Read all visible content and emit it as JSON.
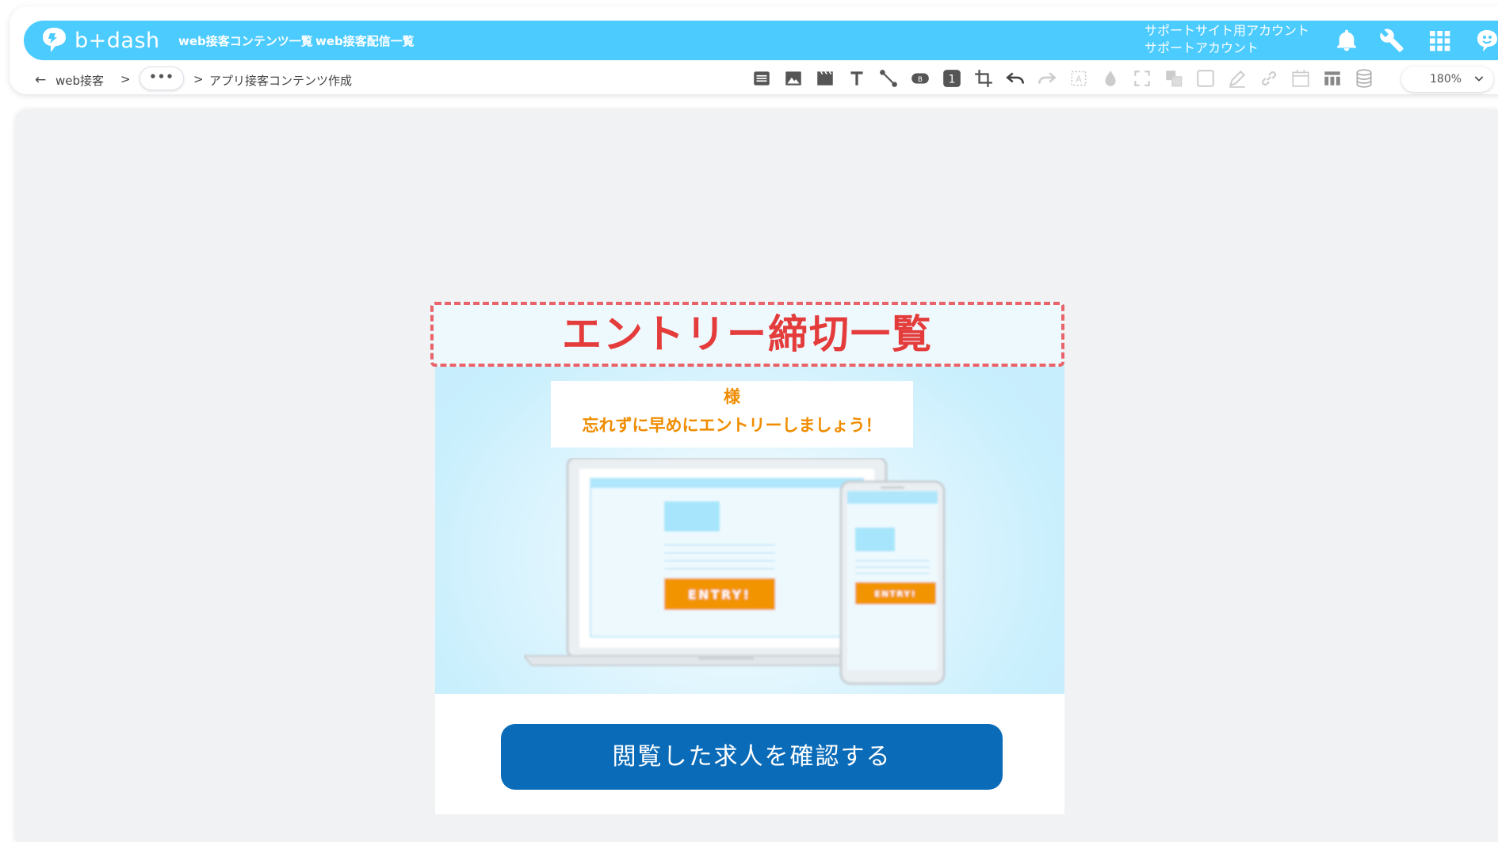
{
  "header": {
    "logo_text": "b+dash",
    "nav": [
      "web接客コンテンツ一覧",
      "web接客配信一覧"
    ],
    "account_line1": "サポートサイト用アカウント",
    "account_line2": "サポートアカウント",
    "icons": [
      "bell-icon",
      "wrench-icon",
      "apps-grid-icon",
      "user-avatar-icon"
    ]
  },
  "breadcrumb": {
    "back_icon": "arrow-left-icon",
    "items": [
      "web接客",
      "•••",
      "アプリ接客コンテンツ作成"
    ],
    "separator": ">"
  },
  "toolbar": {
    "tools": [
      "list-block-icon",
      "image-icon",
      "video-icon",
      "text-icon",
      "connector-icon",
      "button-block-icon",
      "number-badge-icon",
      "crop-icon",
      "undo-icon",
      "redo-icon",
      "text-frame-icon",
      "drop-icon",
      "fullscreen-icon",
      "layers-icon",
      "rectangle-icon",
      "pen-icon",
      "link-icon",
      "calendar-icon",
      "table-icon",
      "database-icon"
    ],
    "number_badge": "1",
    "zoom_value": "180%"
  },
  "content": {
    "title": "エントリー締切一覧",
    "message_line1": "様",
    "message_line2": "忘れずに早めにエントリーしましょう！",
    "entry_label_laptop": "ENTRY!",
    "entry_label_phone": "ENTRY!",
    "cta_label": "閲覧した求人を確認する"
  },
  "colors": {
    "header_bar": "#4ccbff",
    "title_text": "#e43b3b",
    "title_border": "#e8646a",
    "message_text": "#ef8c00",
    "entry_button": "#f29400",
    "cta_button": "#0a6bb8",
    "canvas_bg": "#f1f2f4"
  }
}
